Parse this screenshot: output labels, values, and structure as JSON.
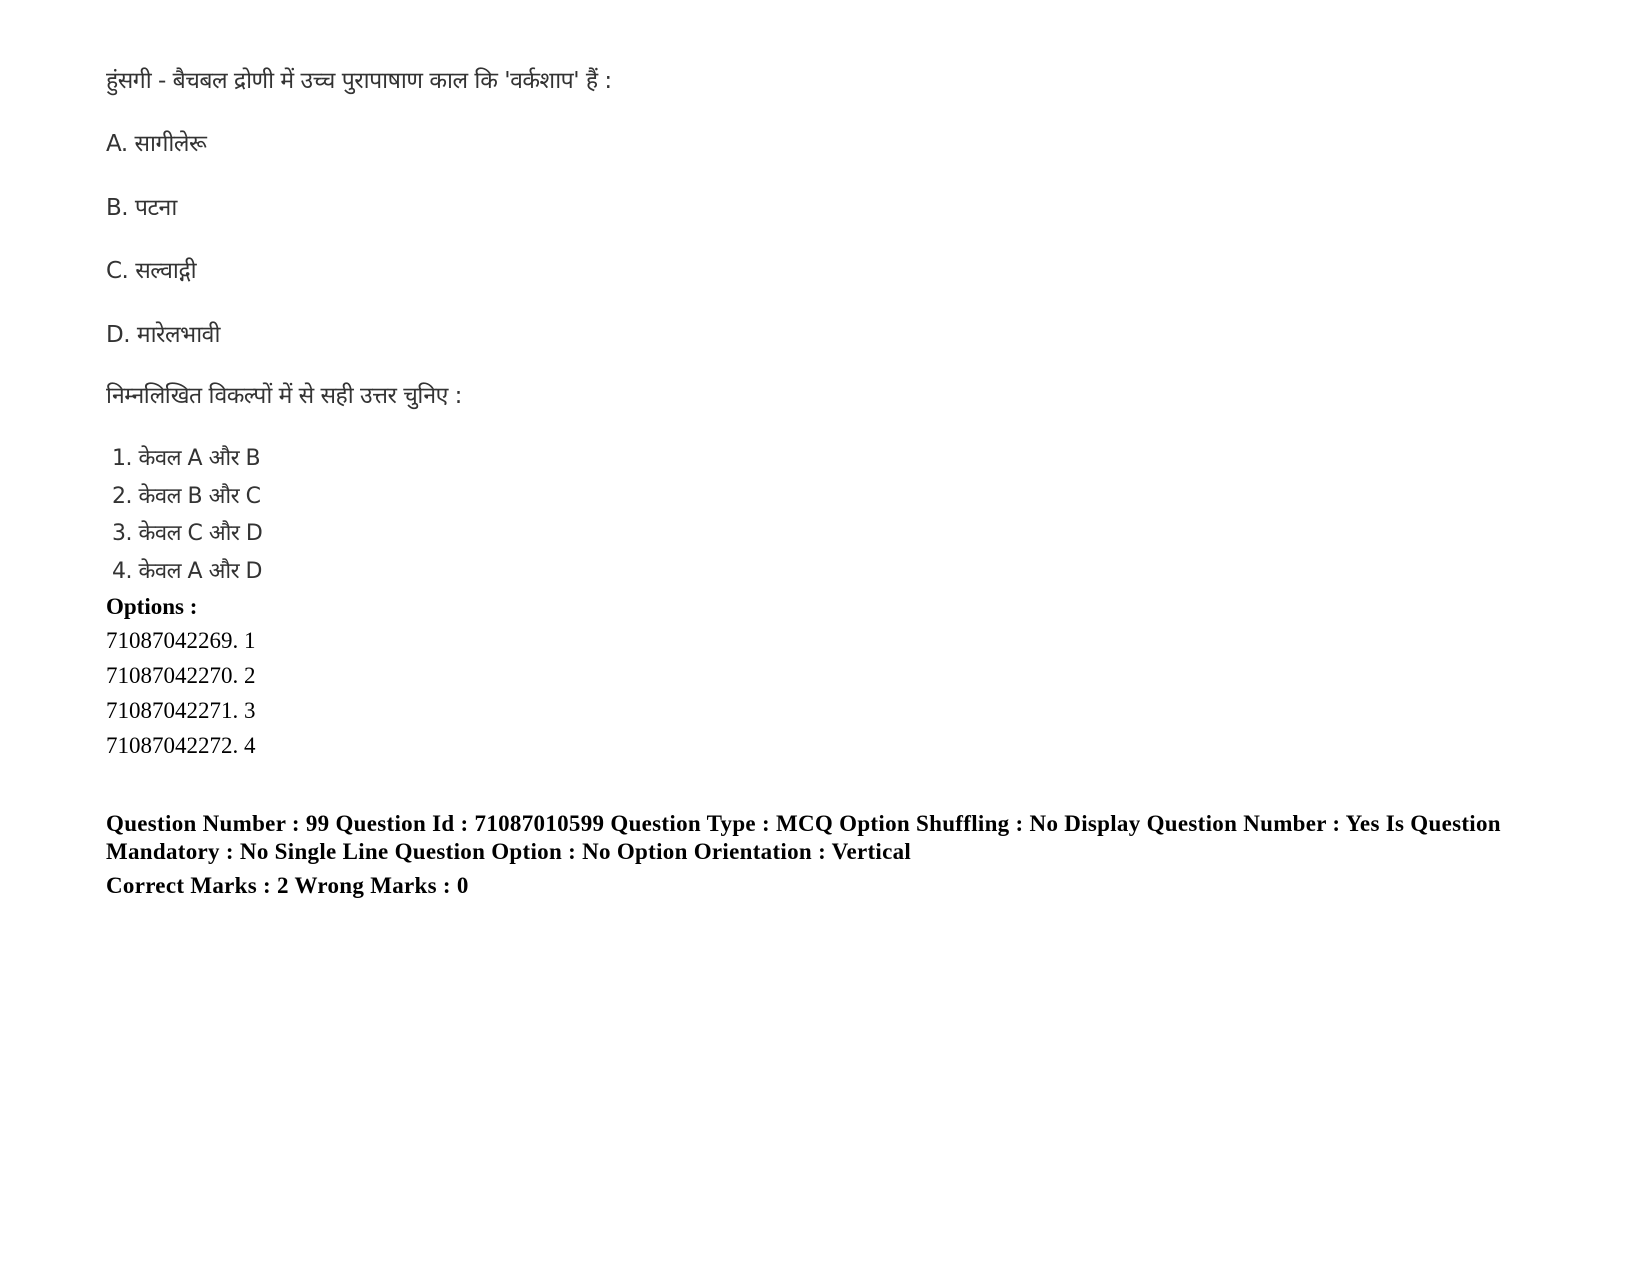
{
  "question": {
    "text": "हुंसगी - बैचबल द्रोणी में उच्च पुरापाषाण काल कि 'वर्कशाप' हैं :",
    "statements": [
      {
        "label": "A.",
        "text": "सागीलेरू"
      },
      {
        "label": "B.",
        "text": "पटना"
      },
      {
        "label": "C.",
        "text": "सल्वाद्गी"
      },
      {
        "label": "D.",
        "text": "मारेलभावी"
      }
    ],
    "instruction": "निम्नलिखित विकल्पों में से सही उत्तर चुनिए :",
    "choices": [
      "1. केवल A और B",
      "2. केवल B और C",
      "3. केवल C और D",
      "4. केवल A और D"
    ]
  },
  "options": {
    "label": "Options :",
    "items": [
      "71087042269. 1",
      "71087042270. 2",
      "71087042271. 3",
      "71087042272. 4"
    ]
  },
  "meta": {
    "details": "Question Number : 99 Question Id : 71087010599 Question Type : MCQ Option Shuffling : No Display Question Number : Yes Is Question Mandatory : No Single Line Question Option : No Option Orientation : Vertical",
    "marks": "Correct Marks : 2 Wrong Marks : 0"
  }
}
